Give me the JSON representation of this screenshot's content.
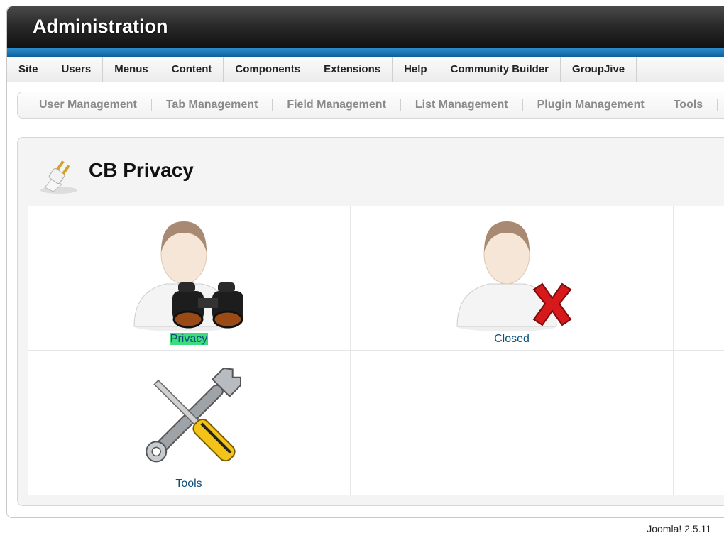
{
  "header": {
    "title": "Administration"
  },
  "menu": {
    "items": [
      "Site",
      "Users",
      "Menus",
      "Content",
      "Components",
      "Extensions",
      "Help",
      "Community Builder",
      "GroupJive"
    ]
  },
  "submenu": {
    "items": [
      "User Management",
      "Tab Management",
      "Field Management",
      "List Management",
      "Plugin Management",
      "Tools"
    ]
  },
  "page": {
    "title": "CB Privacy",
    "icons": [
      {
        "label": "Privacy",
        "icon": "user-binoculars-icon",
        "highlighted": true
      },
      {
        "label": "Closed",
        "icon": "user-closed-icon"
      },
      {
        "label": "Tools",
        "icon": "tools-icon"
      }
    ]
  },
  "footer": {
    "version": "Joomla! 2.5.11"
  }
}
